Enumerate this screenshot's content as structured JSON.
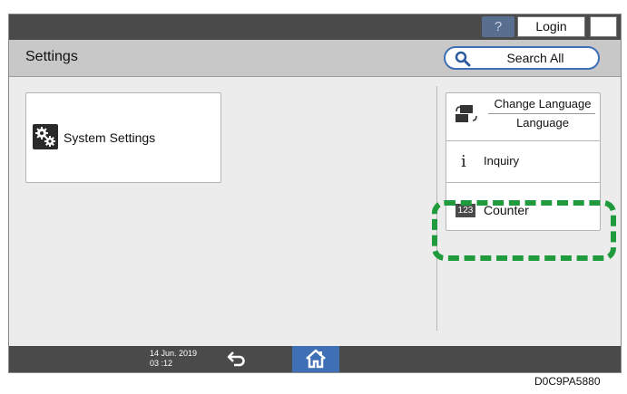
{
  "top_bar": {
    "help_label": "?",
    "login_label": "Login"
  },
  "header": {
    "title": "Settings",
    "search_label": "Search All"
  },
  "main": {
    "system_settings_label": "System Settings",
    "right_panel": {
      "change_language_label": "Change Language",
      "language_value": "Language",
      "inquiry_label": "Inquiry",
      "info_glyph": "i",
      "counter_label": "Counter",
      "counter_icon_text": "123"
    }
  },
  "bottom_bar": {
    "date": "14 Jun. 2019",
    "time": "03 :12"
  },
  "caption": "D0C9PA5880",
  "colors": {
    "accent_blue": "#3f6fb5",
    "highlight_green": "#1f9a3c",
    "bar_dark": "#4a4a4a"
  },
  "icons": [
    "moon-icon",
    "search-icon",
    "gear-icon",
    "language-icon",
    "info-icon",
    "counter-icon",
    "back-arrow-icon",
    "home-icon"
  ]
}
